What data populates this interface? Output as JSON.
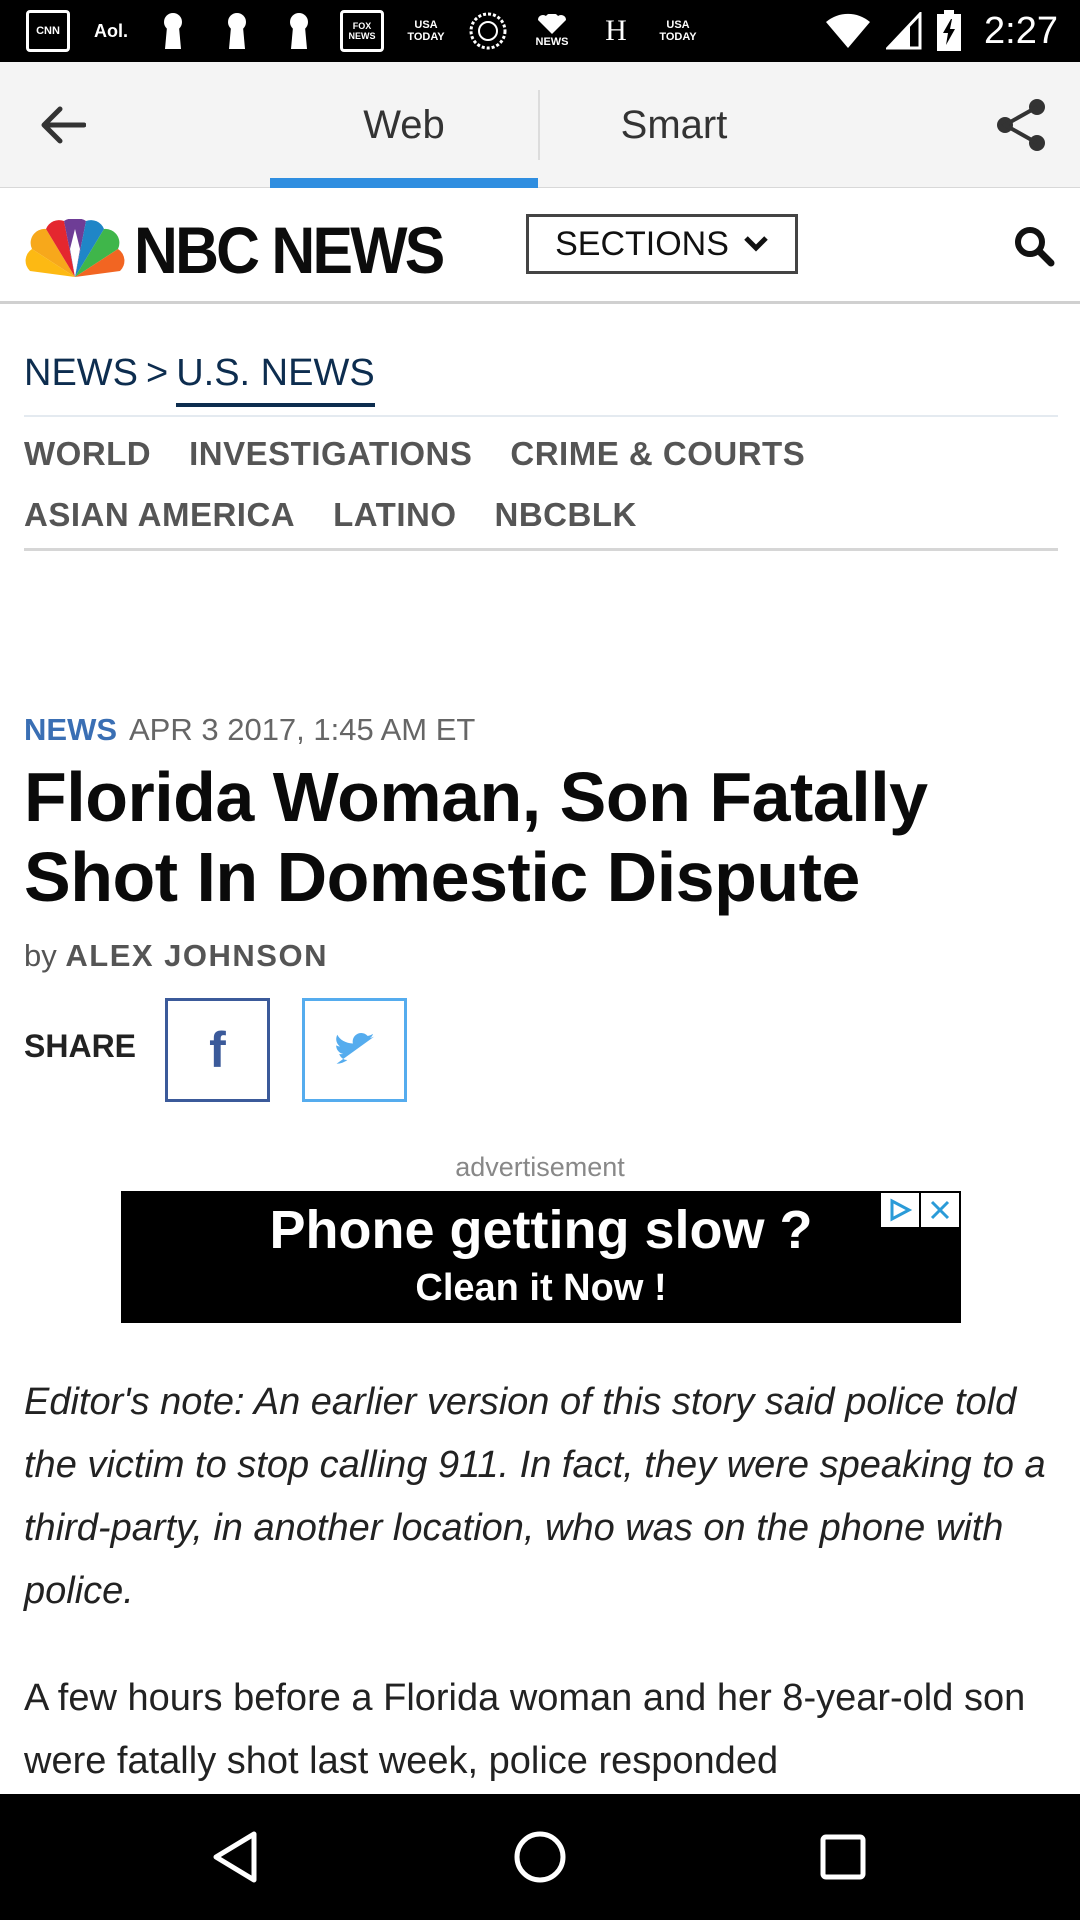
{
  "status_bar": {
    "notifications": [
      {
        "label": "CNN",
        "icon": "cnn-icon"
      },
      {
        "label": "Aol.",
        "icon": "aol-icon"
      },
      {
        "label": "",
        "icon": "keyhole-icon"
      },
      {
        "label": "",
        "icon": "keyhole-icon"
      },
      {
        "label": "",
        "icon": "keyhole-icon"
      },
      {
        "label": "FOX NEWS",
        "icon": "fox-news-icon"
      },
      {
        "label": "USA TODAY",
        "icon": "usa-today-icon"
      },
      {
        "label": "",
        "icon": "circle-seal-icon"
      },
      {
        "label": "NEWS",
        "icon": "nbc-news-icon"
      },
      {
        "label": "H",
        "icon": "huffpost-icon"
      },
      {
        "label": "USA TODAY",
        "icon": "usa-today-icon"
      }
    ],
    "time": "2:27"
  },
  "toolbar": {
    "tabs": [
      {
        "label": "Web",
        "active": true
      },
      {
        "label": "Smart",
        "active": false
      }
    ],
    "accent_color": "#2f8ee0"
  },
  "site_header": {
    "logo_text": "NBC NEWS",
    "sections_label": "SECTIONS"
  },
  "breadcrumb": {
    "parent": "NEWS",
    "separator": ">",
    "current": "U.S. NEWS"
  },
  "categories": {
    "row1": [
      "WORLD",
      "INVESTIGATIONS",
      "CRIME & COURTS"
    ],
    "row2": [
      "ASIAN AMERICA",
      "LATINO",
      "NBCBLK"
    ]
  },
  "article": {
    "section": "NEWS",
    "date": "APR 3 2017, 1:45 AM ET",
    "headline": "Florida Woman, Son Fatally Shot In Domestic Dispute",
    "byline_prefix": "by",
    "author": "ALEX JOHNSON",
    "share_label": "SHARE",
    "share_buttons": [
      {
        "network": "facebook",
        "icon": "facebook-icon",
        "glyph": "f",
        "color": "#3b5a9a"
      },
      {
        "network": "twitter",
        "icon": "twitter-icon",
        "color": "#55acee"
      }
    ],
    "editor_note": "Editor's note: An earlier version of this story said police told the victim to stop calling 911. In fact, they were speaking to a third-party, in another location, who was on the phone with police.",
    "body_start": "A few hours before a Florida woman and her 8-year-old son were fatally shot last week, police responded"
  },
  "ad": {
    "label": "advertisement",
    "line1": "Phone getting slow ?",
    "line2": "Clean it Now !"
  },
  "colors": {
    "link_navy": "#0d2d4f",
    "section_blue": "#3a6fb4"
  }
}
